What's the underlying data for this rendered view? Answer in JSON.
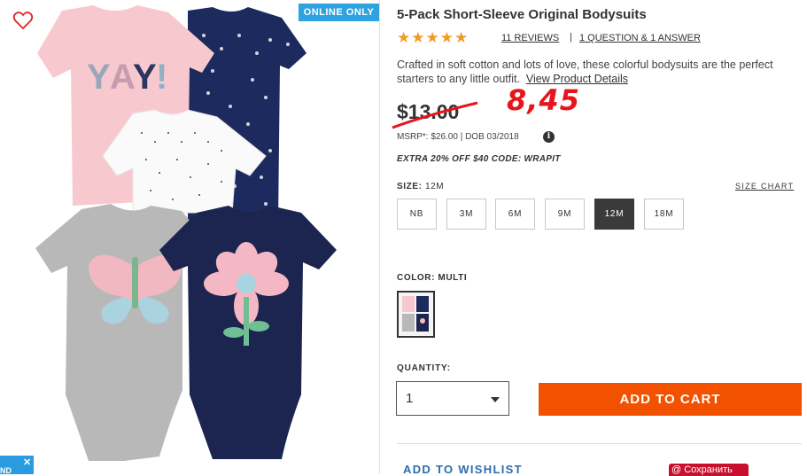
{
  "badge": {
    "online_only": "ONLINE ONLY"
  },
  "favorite": {
    "icon": "heart-outline-icon"
  },
  "chat": {
    "close_label": "✕",
    "text": "ND"
  },
  "product": {
    "title": "5-Pack Short-Sleeve Original Bodysuits",
    "rating_stars": "★★★★★",
    "rating": 5,
    "reviews_link": "11 REVIEWS",
    "separator": "|",
    "qa_link": "1 QUESTION & 1 ANSWER",
    "description": "Crafted in soft cotton and lots of love, these colorful bodysuits are the perfect starters to any little outfit.",
    "details_link": "View Product Details",
    "price": "$13.00",
    "handwritten_price": "8,45",
    "msrp_line": "MSRP*: $26.00 | DOB 03/2018",
    "info_icon_glyph": "i",
    "promo": "EXTRA 20% OFF $40 CODE: WRAPIT"
  },
  "size": {
    "label": "SIZE:",
    "selected_value": "12M",
    "chart_link": "SIZE CHART",
    "options": [
      "NB",
      "3M",
      "6M",
      "9M",
      "12M",
      "18M"
    ],
    "selected": "12M"
  },
  "color": {
    "label": "COLOR: MULTI"
  },
  "quantity": {
    "label": "QUANTITY:",
    "value": "1"
  },
  "actions": {
    "add_to_cart": "ADD TO CART",
    "add_to_wishlist": "ADD TO WISHLIST",
    "save": "@ Сохранить"
  },
  "colors": {
    "accent_orange": "#f25200",
    "star": "#f19b22",
    "badge_blue": "#2fa3e0",
    "handwritten_red": "#e8141b",
    "selected_size_bg": "#3a3a3a"
  }
}
